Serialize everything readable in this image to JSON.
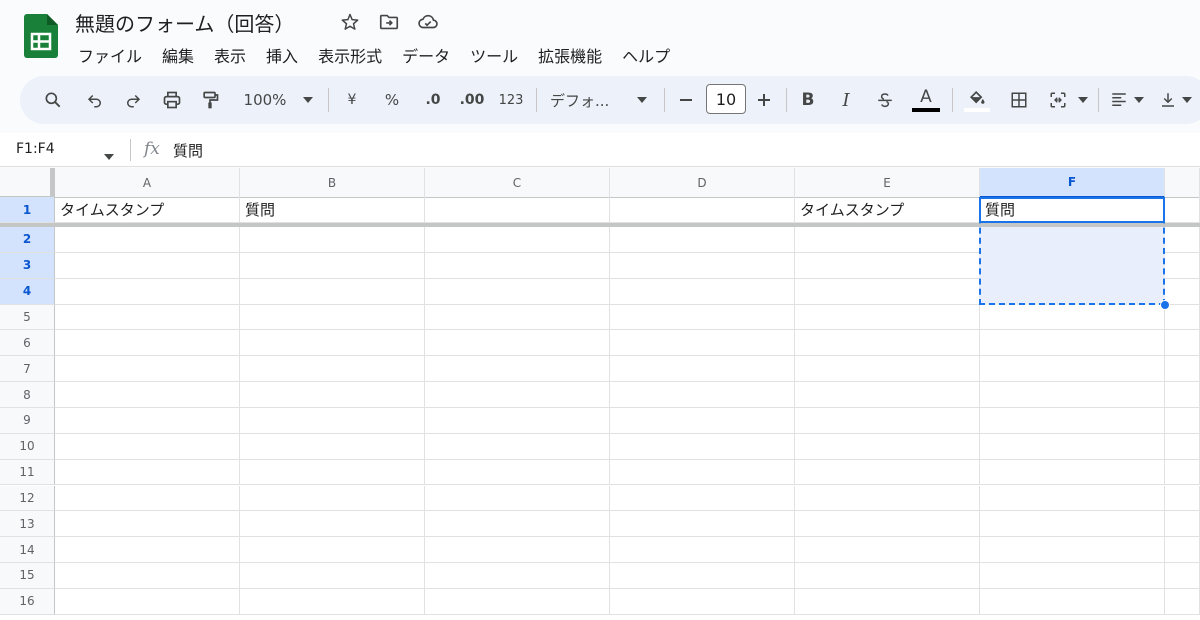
{
  "app": {
    "title": "無題のフォーム（回答）",
    "brand_color": "#188038",
    "accent_color": "#1a73e8"
  },
  "title_icons": [
    "star-icon",
    "move-to-folder-icon",
    "cloud-saved-icon"
  ],
  "menu": [
    {
      "label": "ファイル",
      "name": "menu-file"
    },
    {
      "label": "編集",
      "name": "menu-edit"
    },
    {
      "label": "表示",
      "name": "menu-view"
    },
    {
      "label": "挿入",
      "name": "menu-insert"
    },
    {
      "label": "表示形式",
      "name": "menu-format"
    },
    {
      "label": "データ",
      "name": "menu-data"
    },
    {
      "label": "ツール",
      "name": "menu-tools"
    },
    {
      "label": "拡張機能",
      "name": "menu-extensions"
    },
    {
      "label": "ヘルプ",
      "name": "menu-help"
    }
  ],
  "toolbar": {
    "zoom": "100%",
    "currency": "¥",
    "percent": "%",
    "decimal_decrease": ".0",
    "decimal_increase": ".00",
    "number_format": "123",
    "font": "デフォ...",
    "font_size": "10",
    "bold": "B",
    "italic": "I",
    "text_color": "A",
    "text_color_value": "#000000"
  },
  "formula_bar": {
    "name_box": "F1:F4",
    "fx": "fx",
    "content": "質問"
  },
  "sheet": {
    "columns": [
      "A",
      "B",
      "C",
      "D",
      "E",
      "F"
    ],
    "rows": [
      "1",
      "2",
      "3",
      "4",
      "5",
      "6",
      "7",
      "8",
      "9",
      "10",
      "11",
      "12",
      "13",
      "14",
      "15",
      "16"
    ],
    "cells": {
      "A1": "タイムスタンプ",
      "B1": "質問",
      "E1": "タイムスタンプ",
      "F1": "質問"
    },
    "selected_range": "F1:F4"
  }
}
